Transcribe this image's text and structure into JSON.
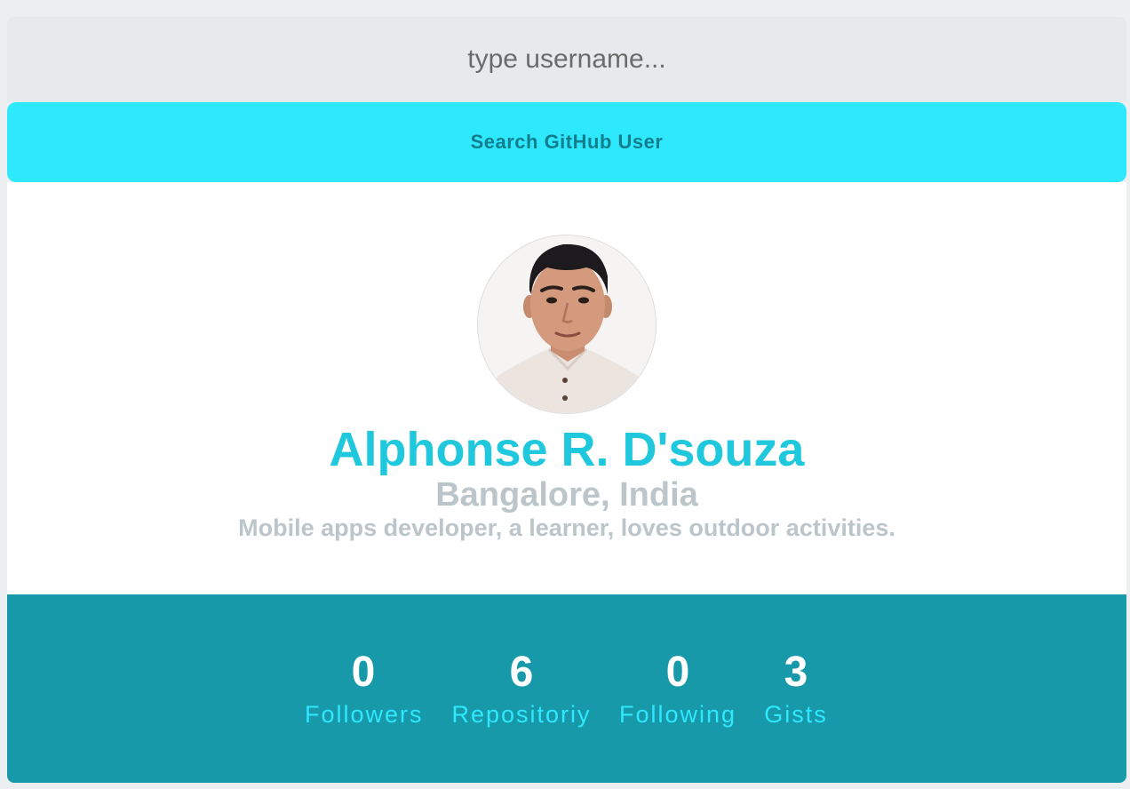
{
  "search": {
    "placeholder": "type username...",
    "button_label": "Search GitHub User"
  },
  "profile": {
    "avatar_alt": "user-avatar",
    "name": "Alphonse R. D'souza",
    "location": "Bangalore, India",
    "bio": "Mobile apps developer, a learner, loves outdoor activities."
  },
  "stats": [
    {
      "count": "0",
      "label": "Followers"
    },
    {
      "count": "6",
      "label": "Repositoriy"
    },
    {
      "count": "0",
      "label": "Following"
    },
    {
      "count": "3",
      "label": "Gists"
    }
  ],
  "colors": {
    "accent": "#2ee8fe",
    "name": "#1fc8dd",
    "stats_bg": "#1899aa",
    "muted": "#bcc6ca"
  }
}
